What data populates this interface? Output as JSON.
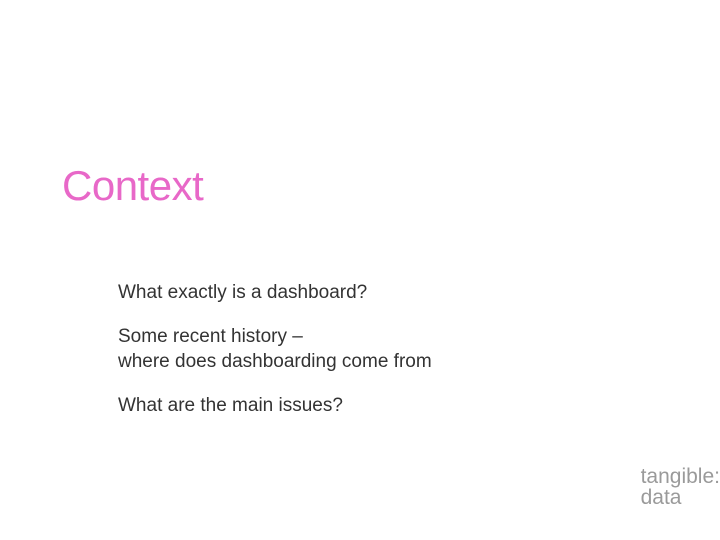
{
  "title": "Context",
  "bullets": [
    "What exactly is a dashboard?",
    "Some recent history –\nwhere does dashboarding come from",
    "What are the main issues?"
  ],
  "logo": {
    "line1": "tangible:",
    "line2": "data"
  }
}
